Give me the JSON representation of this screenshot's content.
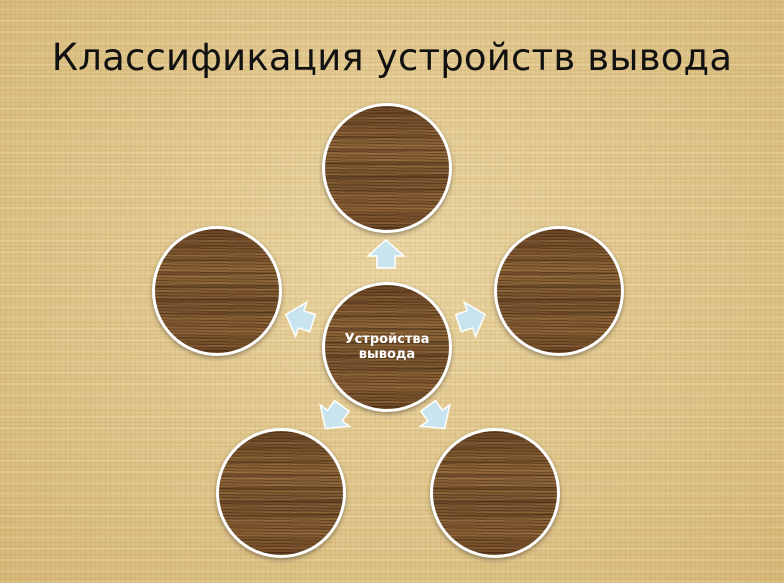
{
  "slide": {
    "title": "Классификация устройств вывода"
  },
  "diagram": {
    "center": {
      "line1": "Устройства",
      "line2": "вывода"
    }
  }
}
